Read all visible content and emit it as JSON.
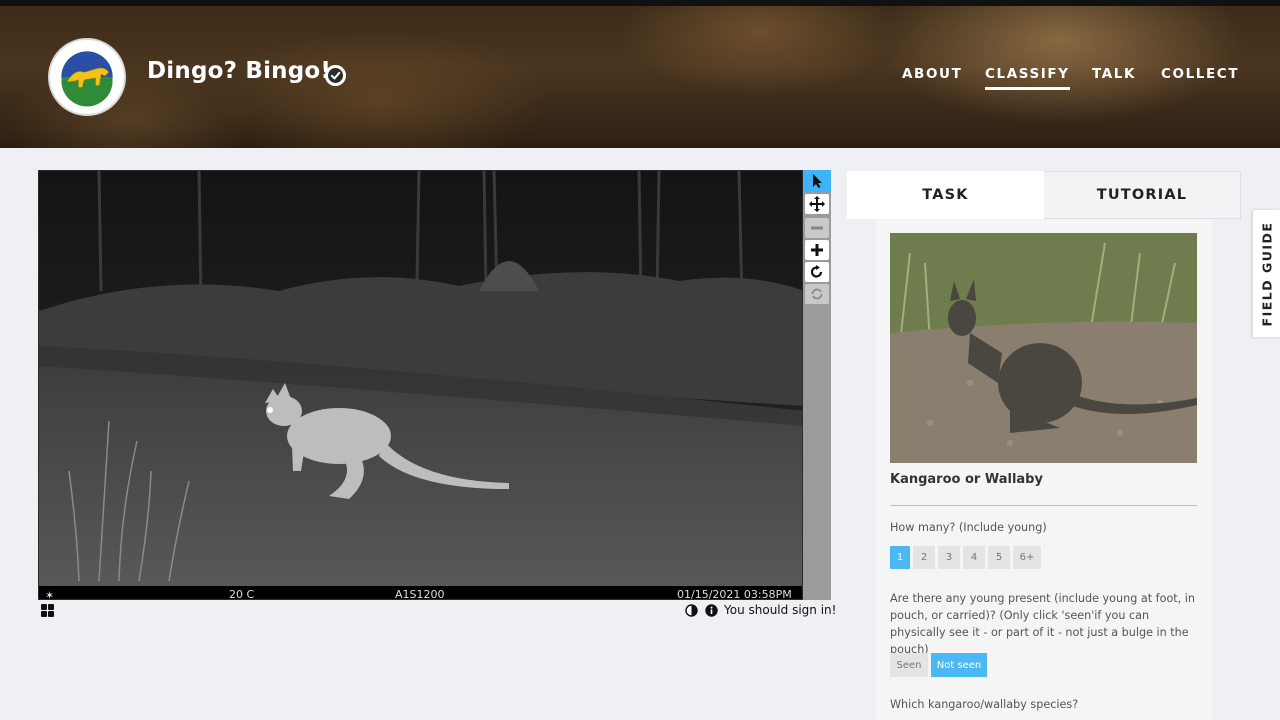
{
  "header": {
    "project_title": "Dingo? Bingo!",
    "verified_icon": "check-badge-icon",
    "logo": {
      "alt": "Myall Lakes Dingo Project logo",
      "text_top": "Myall Lakes",
      "text_bottom": "Dingo Project"
    },
    "nav": [
      {
        "label": "ABOUT",
        "active": false
      },
      {
        "label": "CLASSIFY",
        "active": true
      },
      {
        "label": "TALK",
        "active": false
      },
      {
        "label": "COLLECT",
        "active": false
      }
    ]
  },
  "viewer": {
    "camera_overlay": {
      "temperature": "20 C",
      "camera_id": "A1S1200",
      "timestamp": "01/15/2021  03:58PM"
    },
    "tools": [
      {
        "icon": "pointer-icon",
        "active": true,
        "enabled": true
      },
      {
        "icon": "move-icon",
        "active": false,
        "enabled": true
      },
      {
        "icon": "zoom-out-icon",
        "active": false,
        "enabled": false
      },
      {
        "icon": "zoom-in-icon",
        "active": false,
        "enabled": true
      },
      {
        "icon": "rotate-icon",
        "active": false,
        "enabled": true
      },
      {
        "icon": "reset-icon",
        "active": false,
        "enabled": false
      }
    ],
    "sign_in_message": "You should sign in!"
  },
  "task_panel": {
    "tabs": [
      {
        "label": "TASK",
        "active": true
      },
      {
        "label": "TUTORIAL",
        "active": false
      }
    ],
    "choice_name": "Kangaroo or Wallaby",
    "question_count": "How many? (Include young)",
    "count_options": [
      "1",
      "2",
      "3",
      "4",
      "5",
      "6+"
    ],
    "count_selected": "1",
    "question_young": "Are there any young present (include young at foot, in pouch, or carried)? (Only click 'seen'if you can physically see it - or part of it - not just a bulge in the pouch)",
    "young_options": [
      "Seen",
      "Not seen"
    ],
    "young_selected": "Not seen",
    "question_species": "Which kangaroo/wallaby species?"
  },
  "field_guide": {
    "label": "FIELD GUIDE"
  },
  "colors": {
    "accent": "#3fb3f5",
    "header_bg": "#3a2a18"
  }
}
